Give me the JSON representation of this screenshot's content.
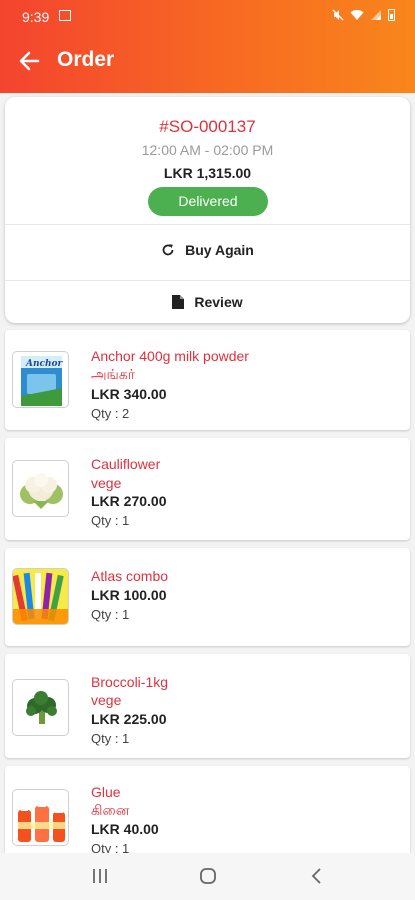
{
  "statusbar": {
    "time": "9:39"
  },
  "header": {
    "title": "Order"
  },
  "order": {
    "number": "#SO-000137",
    "time_slot": "12:00 AM - 02:00 PM",
    "total": "LKR 1,315.00",
    "status": "Delivered",
    "buy_again_label": "Buy Again",
    "review_label": "Review"
  },
  "items": [
    {
      "name": "Anchor 400g milk powder",
      "name_local": "அங்கர்",
      "price": "LKR 340.00",
      "qty": "Qty : 2",
      "icon": "milk-powder-icon"
    },
    {
      "name": "Cauliflower",
      "name_local": "vege",
      "price": "LKR 270.00",
      "qty": "Qty : 1",
      "icon": "cauliflower-icon"
    },
    {
      "name": "Atlas combo",
      "name_local": "",
      "price": "LKR 100.00",
      "qty": "Qty : 1",
      "icon": "stationery-icon"
    },
    {
      "name": "Broccoli-1kg",
      "name_local": "vege",
      "price": "LKR 225.00",
      "qty": "Qty : 1",
      "icon": "broccoli-icon"
    },
    {
      "name": "Glue",
      "name_local": "கினை",
      "price": "LKR 40.00",
      "qty": "Qty : 1",
      "icon": "glue-bottles-icon"
    }
  ],
  "colors": {
    "accent": "#e0313e",
    "status_green": "#4caf50",
    "header_start": "#f4442f",
    "header_end": "#f9861b"
  }
}
